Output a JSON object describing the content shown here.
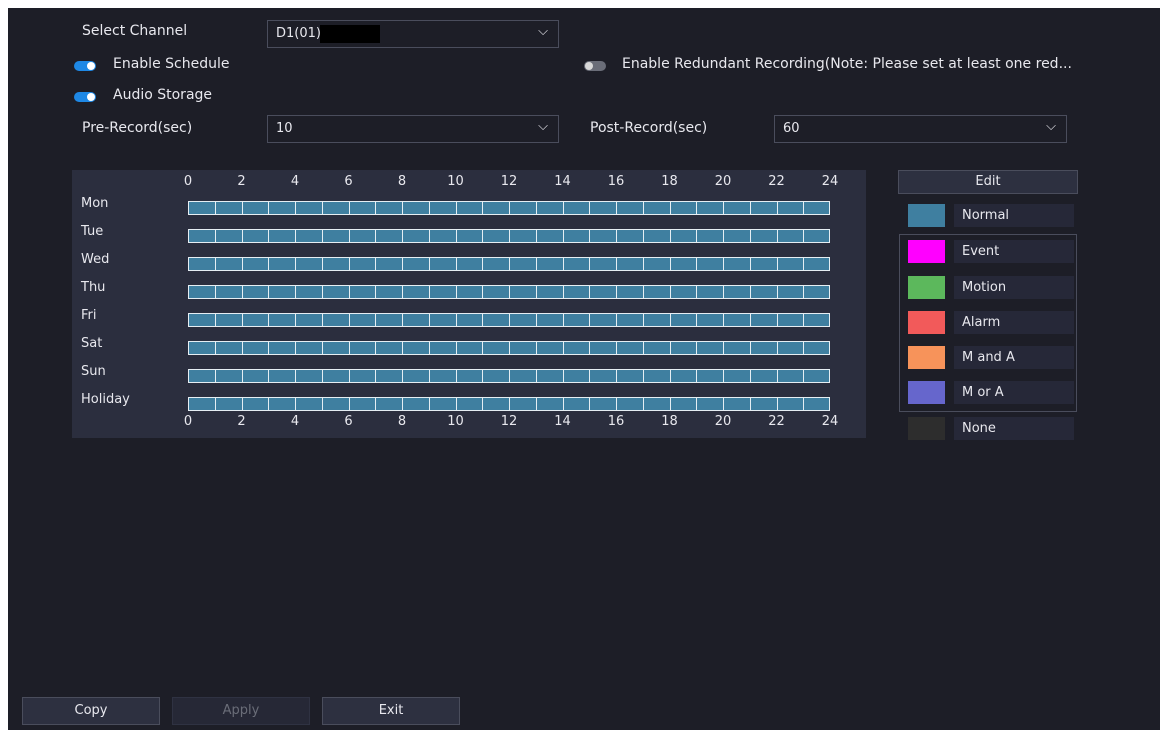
{
  "form": {
    "select_channel_label": "Select Channel",
    "channel_value": "D1(01)",
    "enable_schedule_label": "Enable Schedule",
    "enable_schedule_on": true,
    "redundant_label": "Enable Redundant Recording(Note: Please set at least one red...",
    "redundant_on": false,
    "audio_storage_label": "Audio Storage",
    "audio_storage_on": true,
    "pre_record_label": "Pre-Record(sec)",
    "pre_record_value": "10",
    "post_record_label": "Post-Record(sec)",
    "post_record_value": "60"
  },
  "schedule": {
    "hour_ticks": [
      "0",
      "2",
      "4",
      "6",
      "8",
      "10",
      "12",
      "14",
      "16",
      "18",
      "20",
      "22",
      "24"
    ],
    "days": [
      "Mon",
      "Tue",
      "Wed",
      "Thu",
      "Fri",
      "Sat",
      "Sun",
      "Holiday"
    ],
    "day_modes": [
      "Normal",
      "Normal",
      "Normal",
      "Normal",
      "Normal",
      "Normal",
      "Normal",
      "Normal"
    ]
  },
  "legend": {
    "edit_label": "Edit",
    "items": [
      {
        "label": "Normal",
        "color": "#3f7fa0"
      },
      {
        "label": "Event",
        "color": "#ff00ff"
      },
      {
        "label": "Motion",
        "color": "#5cb85c"
      },
      {
        "label": "Alarm",
        "color": "#f25a5a"
      },
      {
        "label": "M and A",
        "color": "#f7935a"
      },
      {
        "label": "M or A",
        "color": "#6666cc"
      },
      {
        "label": "None",
        "color": "#2d2d2d"
      }
    ]
  },
  "buttons": {
    "copy": "Copy",
    "apply": "Apply",
    "exit": "Exit"
  }
}
